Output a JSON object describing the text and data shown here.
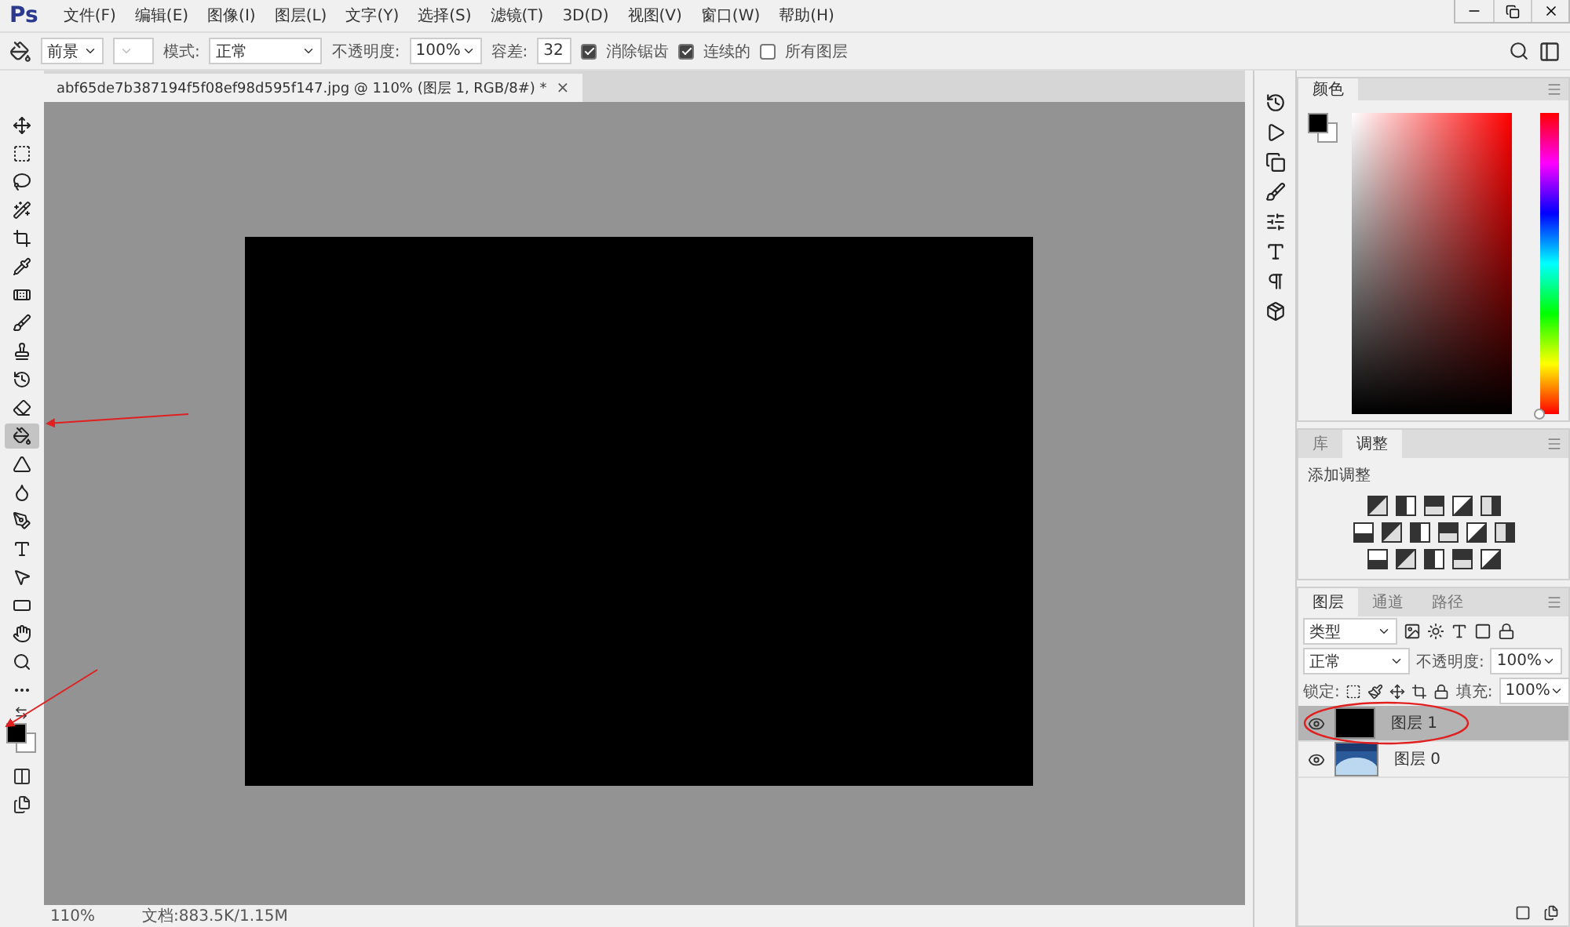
{
  "app": {
    "logo": "Ps"
  },
  "menu": [
    "文件(F)",
    "编辑(E)",
    "图像(I)",
    "图层(L)",
    "文字(Y)",
    "选择(S)",
    "滤镜(T)",
    "3D(D)",
    "视图(V)",
    "窗口(W)",
    "帮助(H)"
  ],
  "options": {
    "fill_source": "前景",
    "mode_label": "模式:",
    "mode": "正常",
    "opacity_label": "不透明度:",
    "opacity": "100%",
    "tolerance_label": "容差:",
    "tolerance": "32",
    "checks": [
      {
        "label": "消除锯齿",
        "checked": true
      },
      {
        "label": "连续的",
        "checked": true
      },
      {
        "label": "所有图层",
        "checked": false
      }
    ]
  },
  "document_tab": {
    "title": "abf65de7b387194f5f08ef98d595f147.jpg @ 110% (图层 1, RGB/8#) *",
    "close": "×"
  },
  "tools": [
    {
      "kind": "move",
      "selected": false
    },
    {
      "kind": "marquee",
      "selected": false
    },
    {
      "kind": "lasso",
      "selected": false
    },
    {
      "kind": "wand",
      "selected": false
    },
    {
      "kind": "crop",
      "selected": false
    },
    {
      "kind": "eyedropper",
      "selected": false
    },
    {
      "kind": "healing",
      "selected": false
    },
    {
      "kind": "brush",
      "selected": false
    },
    {
      "kind": "stamp",
      "selected": false
    },
    {
      "kind": "history",
      "selected": false
    },
    {
      "kind": "eraser",
      "selected": false
    },
    {
      "kind": "bucket",
      "selected": true
    },
    {
      "kind": "blur",
      "selected": false
    },
    {
      "kind": "dodge",
      "selected": false
    },
    {
      "kind": "pen",
      "selected": false
    },
    {
      "kind": "type",
      "selected": false
    },
    {
      "kind": "select",
      "selected": false
    },
    {
      "kind": "shape",
      "selected": false
    },
    {
      "kind": "hand",
      "selected": false
    },
    {
      "kind": "zoom",
      "selected": false
    },
    {
      "kind": "more",
      "selected": false
    }
  ],
  "color_panel": {
    "tab": "颜色",
    "hue": {
      "level": 0
    }
  },
  "adjust_panel": {
    "tabs": [
      {
        "label": "库",
        "selected": false
      },
      {
        "label": "调整",
        "selected": true
      }
    ],
    "heading": "添加调整"
  },
  "layers_panel": {
    "tabs": [
      {
        "label": "图层",
        "selected": true
      },
      {
        "label": "通道",
        "selected": false
      },
      {
        "label": "路径",
        "selected": false
      }
    ],
    "filter": "类型",
    "blend": "正常",
    "opacity_label": "不透明度:",
    "opacity": "100%",
    "lock_label": "锁定:",
    "fill_label": "填充:",
    "fill": "100%",
    "layers": [
      {
        "name": "图层 1",
        "selected": true,
        "kind": "solid"
      },
      {
        "name": "图层 0",
        "selected": false,
        "kind": "picture"
      }
    ]
  },
  "status_bar": {
    "zoom": "110%",
    "doc": "文档:883.5K/1.15M"
  }
}
